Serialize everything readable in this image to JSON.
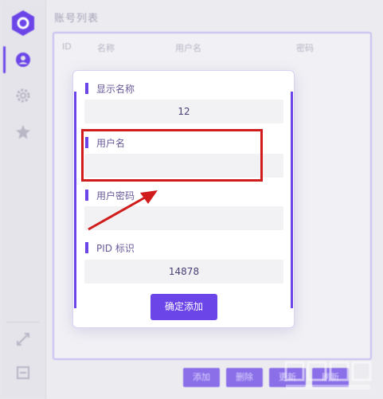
{
  "window": {
    "title": "账号列表"
  },
  "table": {
    "columns": [
      "ID",
      "名称",
      "用户名",
      "密码"
    ]
  },
  "toolbar": {
    "buttons": [
      "添加",
      "删除",
      "更新",
      "刷新"
    ]
  },
  "modal": {
    "fields": [
      {
        "label": "显示名称",
        "value": "12"
      },
      {
        "label": "用户名",
        "value": ""
      },
      {
        "label": "用户密码",
        "value": ""
      },
      {
        "label": "PID 标识",
        "value": "14878"
      }
    ],
    "confirm_label": "确定添加"
  },
  "colors": {
    "accent": "#6b45e8",
    "annotation": "#d01c1c"
  },
  "icons": [
    "app-logo-icon",
    "user-icon",
    "gear-icon",
    "star-icon",
    "expand-icon",
    "exit-icon"
  ]
}
